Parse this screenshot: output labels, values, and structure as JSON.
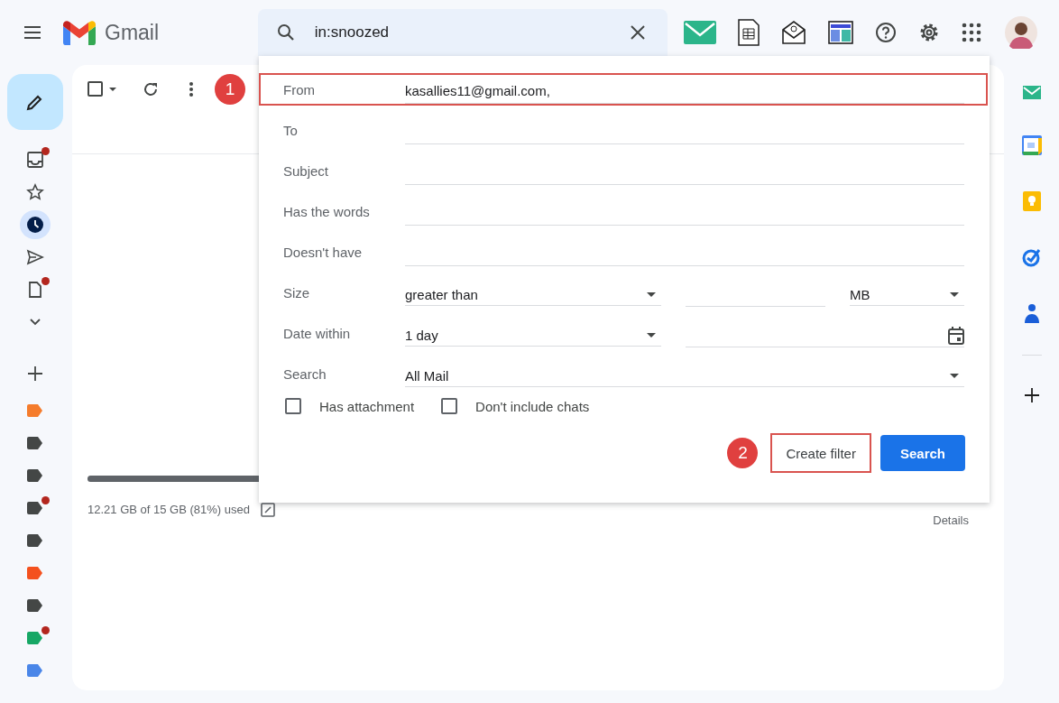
{
  "header": {
    "product": "Gmail",
    "search": {
      "value": "in:snoozed"
    }
  },
  "nav": [
    {
      "kind": "inbox",
      "selected": false,
      "unread": true
    },
    {
      "kind": "starred",
      "selected": false,
      "unread": false
    },
    {
      "kind": "snoozed",
      "selected": true,
      "unread": false
    },
    {
      "kind": "sent",
      "selected": false,
      "unread": false
    },
    {
      "kind": "drafts",
      "selected": false,
      "unread": true
    },
    {
      "kind": "more",
      "selected": false,
      "unread": false
    }
  ],
  "labels": [
    {
      "color": "#f57c2c",
      "unread": false
    },
    {
      "color": "#444746",
      "unread": false
    },
    {
      "color": "#444746",
      "unread": false
    },
    {
      "color": "#444746",
      "unread": true
    },
    {
      "color": "#444746",
      "unread": false
    },
    {
      "color": "#f4511e",
      "unread": false
    },
    {
      "color": "#444746",
      "unread": false
    },
    {
      "color": "#16a765",
      "unread": true
    },
    {
      "color": "#4a86e8",
      "unread": false
    }
  ],
  "toolbar": {
    "select_all": {
      "checked": false
    }
  },
  "storage": {
    "text": "12.21 GB of 15 GB (81%) used",
    "level": 0.81,
    "details": "Details"
  },
  "filter": {
    "rows": [
      {
        "kind": "text",
        "label": "From",
        "value": "kasallies11@gmail.com,",
        "highlighted": true,
        "step": "1"
      },
      {
        "kind": "text",
        "label": "To",
        "highlighted": false
      },
      {
        "kind": "text",
        "label": "Subject",
        "highlighted": false
      },
      {
        "kind": "text",
        "label": "Has the words",
        "highlighted": false
      },
      {
        "kind": "text",
        "label": "Doesn't have",
        "highlighted": false
      },
      {
        "kind": "size",
        "label": "Size",
        "operator": "greater than",
        "unit": "MB",
        "highlighted": false
      },
      {
        "kind": "date",
        "label": "Date within",
        "period": "1 day",
        "highlighted": false
      },
      {
        "kind": "select",
        "label": "Search",
        "value": "All Mail",
        "highlighted": false
      }
    ],
    "checkboxes": [
      {
        "label": "Has attachment",
        "checked": false
      },
      {
        "label": "Don't include chats",
        "checked": false
      }
    ],
    "buttons": [
      {
        "kind": "secondary",
        "label": "Create filter",
        "highlighted": true,
        "step": "2"
      },
      {
        "kind": "primary",
        "label": "Search",
        "highlighted": false
      }
    ]
  }
}
